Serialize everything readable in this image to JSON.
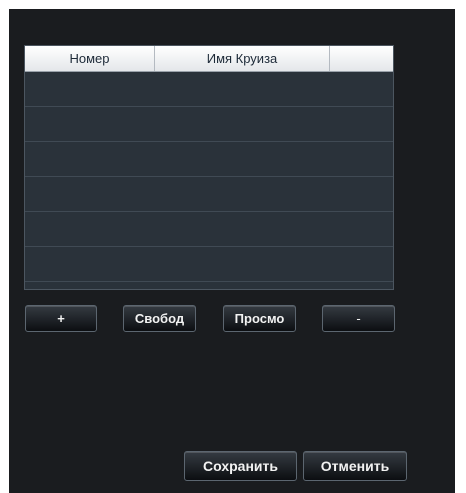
{
  "table": {
    "columns": [
      "Номер",
      "Имя Круиза",
      ""
    ],
    "rows": [
      [],
      [],
      [],
      [],
      [],
      [],
      []
    ]
  },
  "buttons": {
    "add": "+",
    "free": "Свобод",
    "view": "Просмо",
    "remove": "-",
    "save": "Сохранить",
    "cancel": "Отменить"
  }
}
